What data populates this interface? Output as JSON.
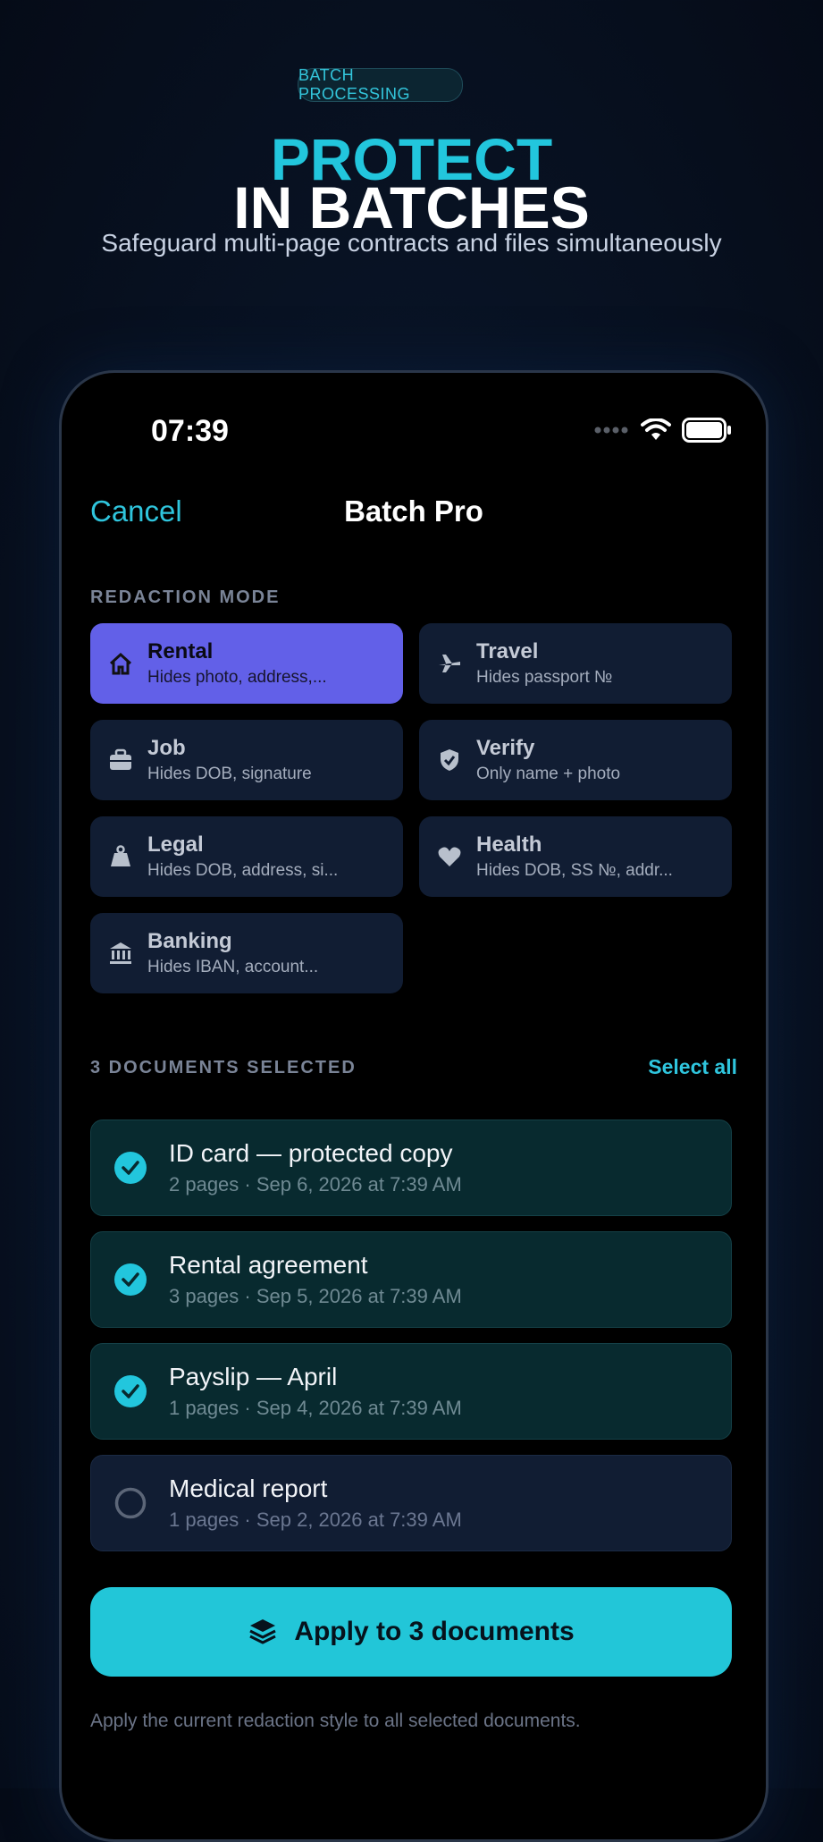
{
  "promo": {
    "badge": "BATCH PROCESSING",
    "headline_line1": "PROTECT",
    "headline_line2": "IN BATCHES",
    "subtitle": "Safeguard multi-page contracts and files simultaneously"
  },
  "status_bar": {
    "time": "07:39"
  },
  "nav": {
    "cancel_label": "Cancel",
    "title": "Batch Pro"
  },
  "redaction": {
    "section_label": "REDACTION MODE",
    "modes": [
      {
        "title": "Rental",
        "subtitle": "Hides photo, address,...",
        "icon": "house-icon",
        "selected": true
      },
      {
        "title": "Travel",
        "subtitle": "Hides passport №",
        "icon": "airplane-icon",
        "selected": false
      },
      {
        "title": "Job",
        "subtitle": "Hides DOB, signature",
        "icon": "briefcase-icon",
        "selected": false
      },
      {
        "title": "Verify",
        "subtitle": "Only name + photo",
        "icon": "shield-check-icon",
        "selected": false
      },
      {
        "title": "Legal",
        "subtitle": "Hides DOB, address, si...",
        "icon": "weight-icon",
        "selected": false
      },
      {
        "title": "Health",
        "subtitle": "Hides DOB, SS №, addr...",
        "icon": "heart-icon",
        "selected": false
      },
      {
        "title": "Banking",
        "subtitle": "Hides IBAN, account...",
        "icon": "bank-icon",
        "selected": false
      }
    ]
  },
  "documents": {
    "section_label": "3 DOCUMENTS SELECTED",
    "select_all_label": "Select all",
    "items": [
      {
        "title": "ID card — protected copy",
        "meta": "2 pages · Sep 6, 2026 at 7:39 AM",
        "checked": true
      },
      {
        "title": "Rental agreement",
        "meta": "3 pages · Sep 5, 2026 at 7:39 AM",
        "checked": true
      },
      {
        "title": "Payslip — April",
        "meta": "1 pages · Sep 4, 2026 at 7:39 AM",
        "checked": true
      },
      {
        "title": "Medical report",
        "meta": "1 pages · Sep 2, 2026 at 7:39 AM",
        "checked": false
      }
    ]
  },
  "apply_button_label": "Apply to 3 documents",
  "footnote": "Apply the current redaction style to all selected documents.",
  "colors": {
    "accent": "#22c6dd",
    "selected_mode": "#6260e8",
    "card": "#111d33",
    "checked_card": "#082a2f",
    "background": "#081223"
  }
}
